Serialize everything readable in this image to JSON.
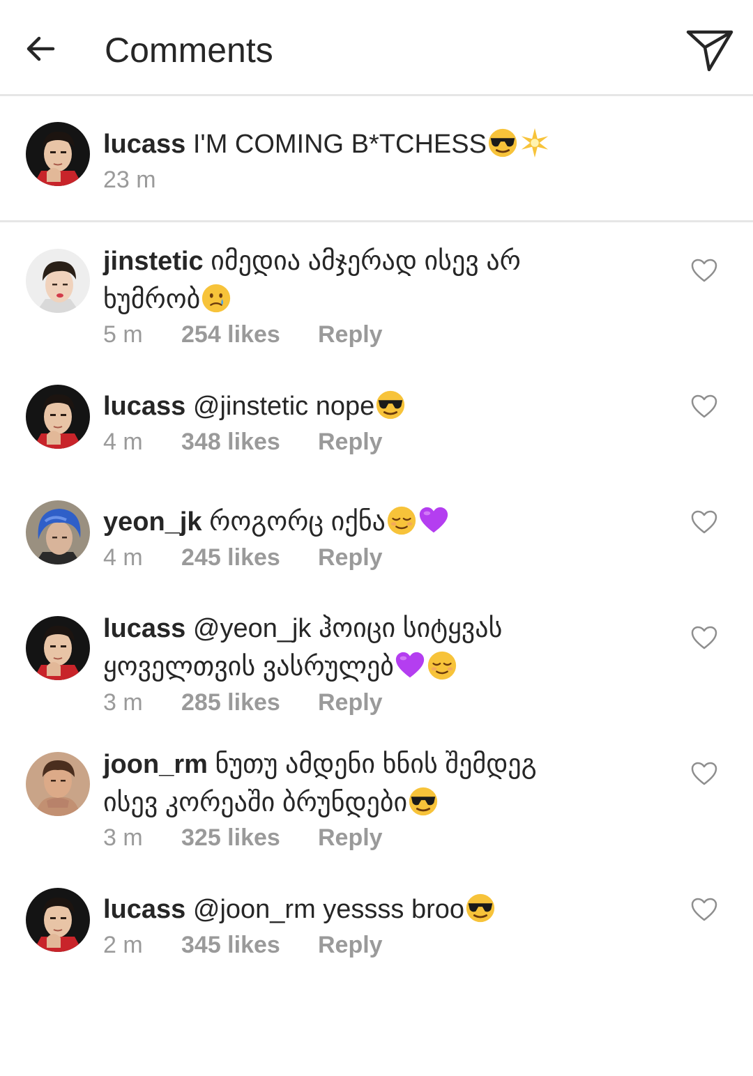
{
  "header": {
    "title": "Comments",
    "back_icon": "arrow-left-icon",
    "share_icon": "paper-plane-icon"
  },
  "caption": {
    "username": "lucass",
    "text": "I'M COMING B*TCHESS",
    "emojis": [
      "sunglasses-face",
      "sparkle-star"
    ],
    "time": "23 m"
  },
  "comments": [
    {
      "username": "jinstetic",
      "text_line1": "იმედია ამჯერად ისევ არ",
      "text_line2": "ხუმრობ",
      "emojis": [
        "smiling-face-with-tear"
      ],
      "time": "5 m",
      "likes": "254 likes",
      "reply": "Reply"
    },
    {
      "username": "lucass",
      "text_line1": "@jinstetic nope",
      "emojis": [
        "sunglasses-face"
      ],
      "time": "4 m",
      "likes": "348 likes",
      "reply": "Reply"
    },
    {
      "username": "yeon_jk",
      "text_line1": "როგორც იქნა",
      "emojis": [
        "relieved-face",
        "purple-heart"
      ],
      "time": "4 m",
      "likes": "245 likes",
      "reply": "Reply"
    },
    {
      "username": "lucass",
      "text_line1": "@yeon_jk ჰოიცი სიტყვას",
      "text_line2": "ყოველთვის ვასრულებ",
      "emojis": [
        "purple-heart",
        "relieved-face"
      ],
      "time": "3 m",
      "likes": "285 likes",
      "reply": "Reply"
    },
    {
      "username": "joon_rm",
      "text_line1": "ნუთუ ამდენი ხნის შემდეგ",
      "text_line2": "ისევ კორეაში ბრუნდები",
      "emojis": [
        "sunglasses-face"
      ],
      "time": "3 m",
      "likes": "325 likes",
      "reply": "Reply"
    },
    {
      "username": "lucass",
      "text_line1": "@joon_rm yessss broo",
      "emojis": [
        "sunglasses-face"
      ],
      "time": "2 m",
      "likes": "345 likes",
      "reply": "Reply"
    }
  ],
  "colors": {
    "text": "#262626",
    "meta": "#9a9a9a",
    "divider": "#e6e6e6",
    "emoji_yellow": "#f7c33a",
    "purple_heart": "#b43ef0"
  }
}
